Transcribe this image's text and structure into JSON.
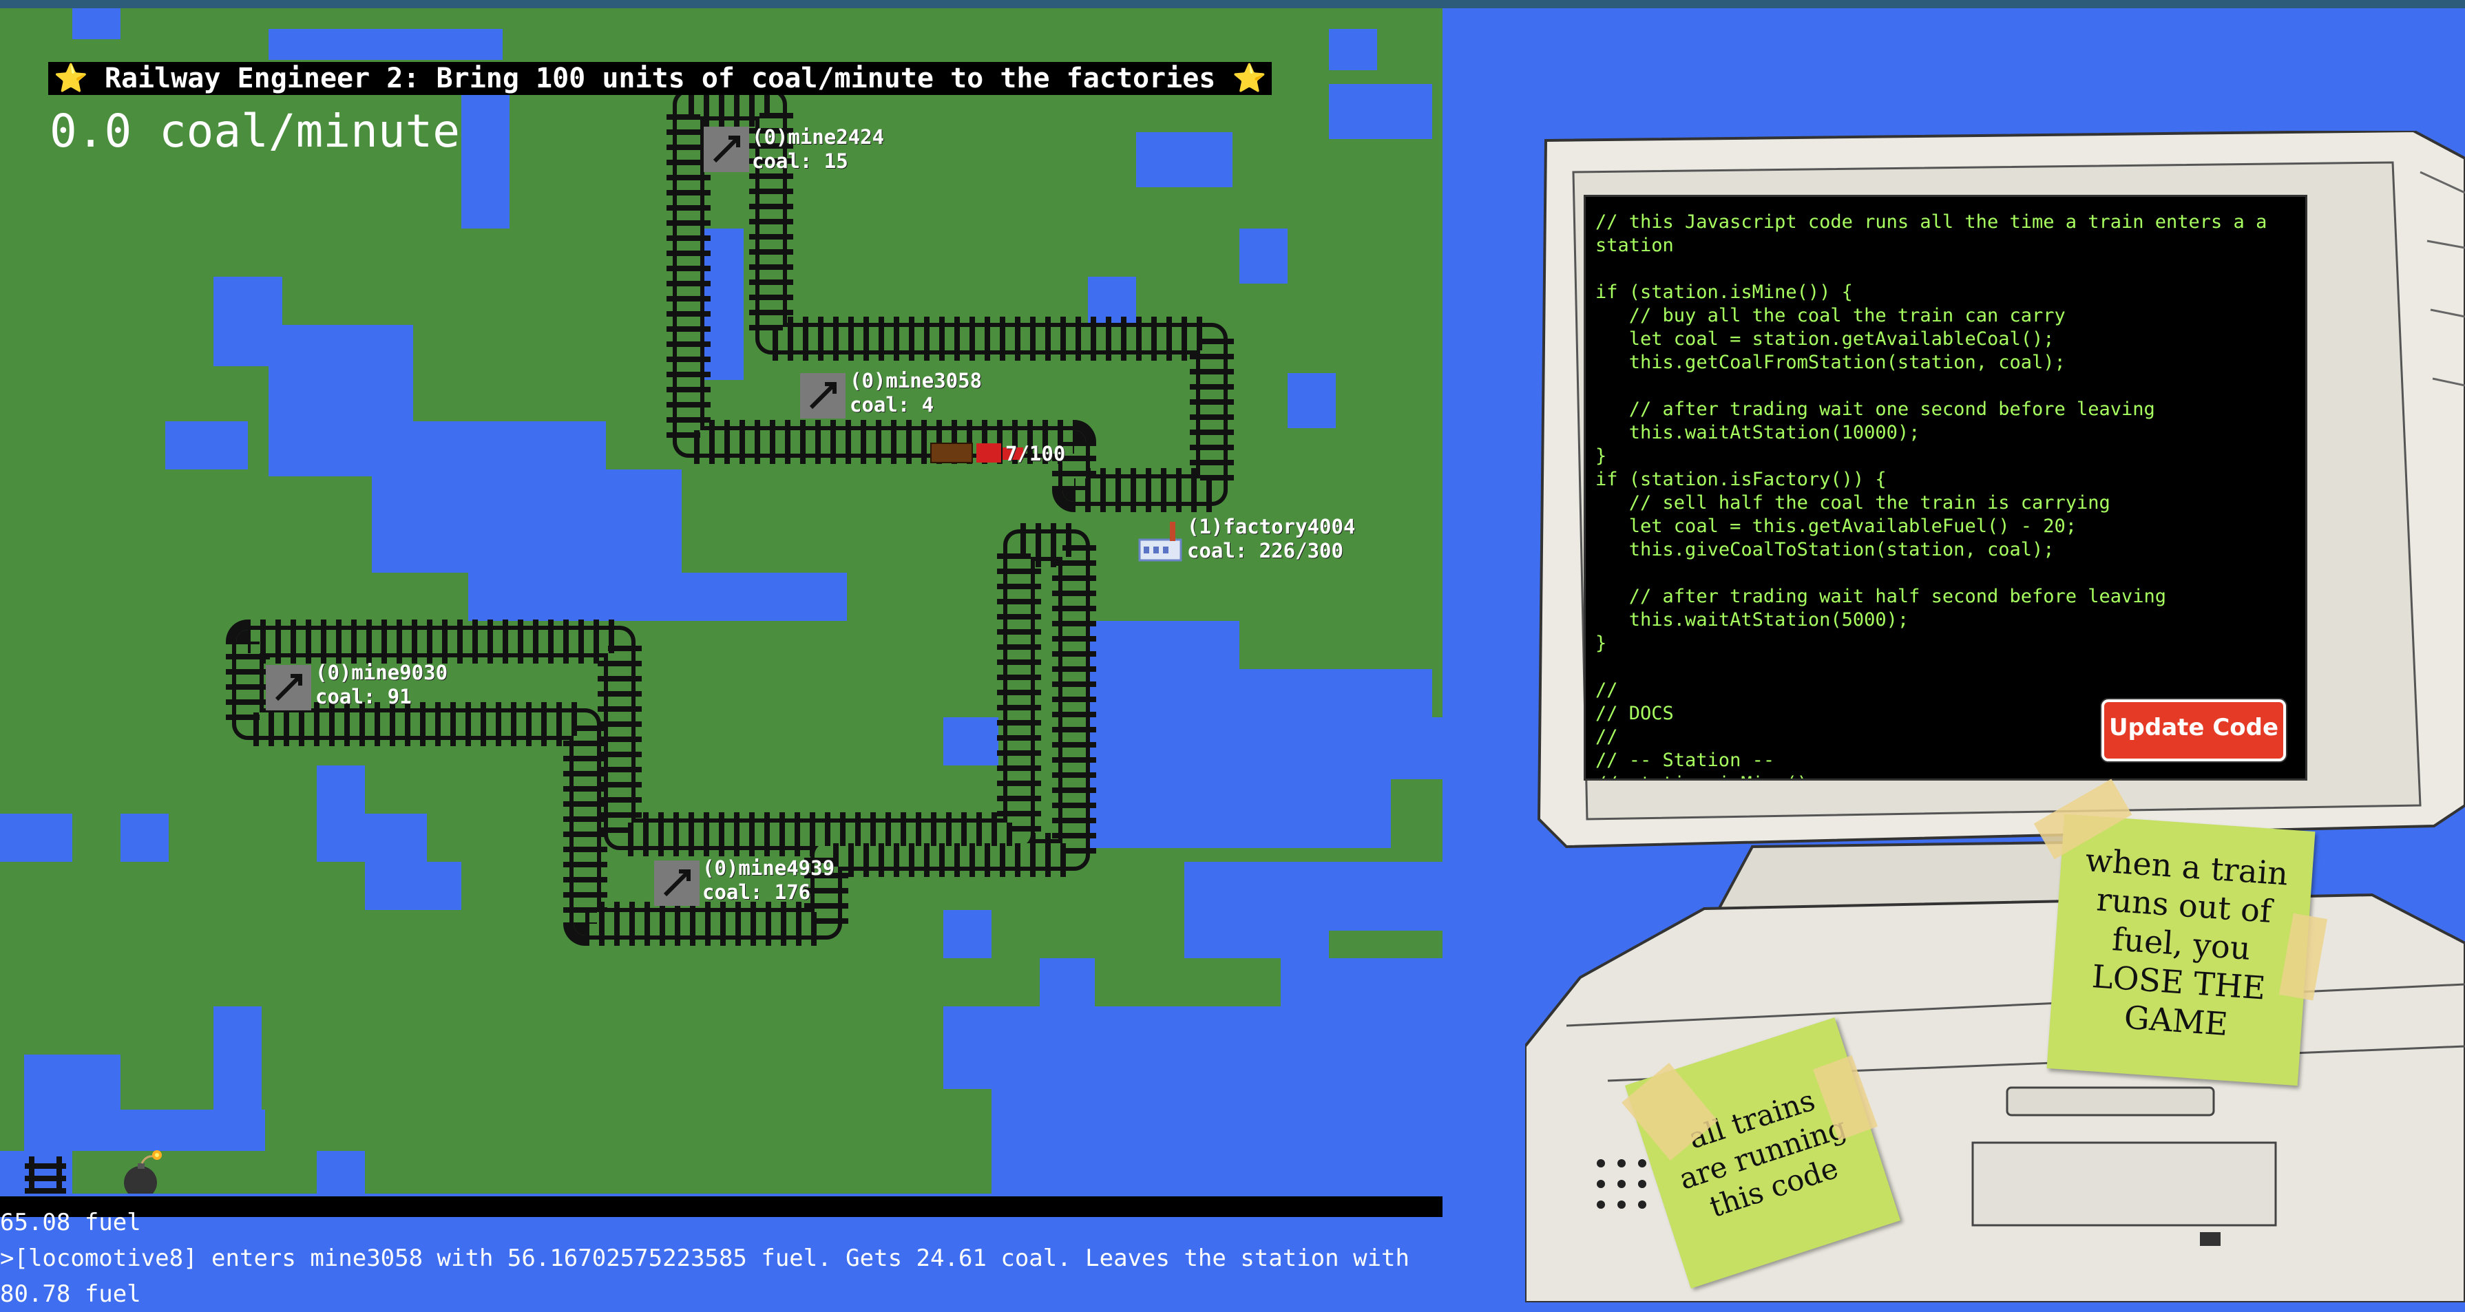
{
  "game": {
    "title": "⭐ Railway Engineer 2: Bring 100 units of coal/minute to the factories ⭐",
    "rate": "0.0 coal/minute",
    "stations": [
      {
        "name": "(0)mine2424",
        "coal": "coal: 15"
      },
      {
        "name": "(0)mine3058",
        "coal": "coal: 4"
      },
      {
        "name": "(1)factory4004",
        "coal": "coal: 226/300"
      },
      {
        "name": "(0)mine9030",
        "coal": "coal: 91"
      },
      {
        "name": "(0)mine4939",
        "coal": "coal: 176"
      }
    ],
    "train_label": "7/100",
    "icons": [
      "pickaxe-icon",
      "factory-icon",
      "track-icon",
      "bomb-icon",
      "locomotive-icon"
    ]
  },
  "console": {
    "fuel_line": "65.08 fuel",
    "log_line1": ">[locomotive8] enters mine3058 with 56.16702575223585 fuel. Gets 24.61 coal. Leaves the station with",
    "log_line2": "80.78 fuel"
  },
  "editor": {
    "code": "// this Javascript code runs all the time a train enters a a station\n\nif (station.isMine()) {\n   // buy all the coal the train can carry\n   let coal = station.getAvailableCoal();\n   this.getCoalFromStation(station, coal);\n\n   // after trading wait one second before leaving\n   this.waitAtStation(10000);\n}\nif (station.isFactory()) {\n   // sell half the coal the train is carrying\n   let coal = this.getAvailableFuel() - 20;\n   this.giveCoalToStation(station, coal);\n\n   // after trading wait half second before leaving\n   this.waitAtStation(5000);\n}\n\n//\n// DOCS\n//\n// -- Station --\n// station.isMine()",
    "button": "Update Code"
  },
  "notes": {
    "right": [
      "when a train",
      "runs out of",
      "fuel, you",
      "LOSE THE",
      "GAME"
    ],
    "left": [
      "all trains",
      "are running",
      "this code"
    ]
  },
  "colors": {
    "grass": "#4a8e3e",
    "water": "#3f6ff0",
    "code_text": "#a8ff60",
    "button": "#e53b26"
  }
}
